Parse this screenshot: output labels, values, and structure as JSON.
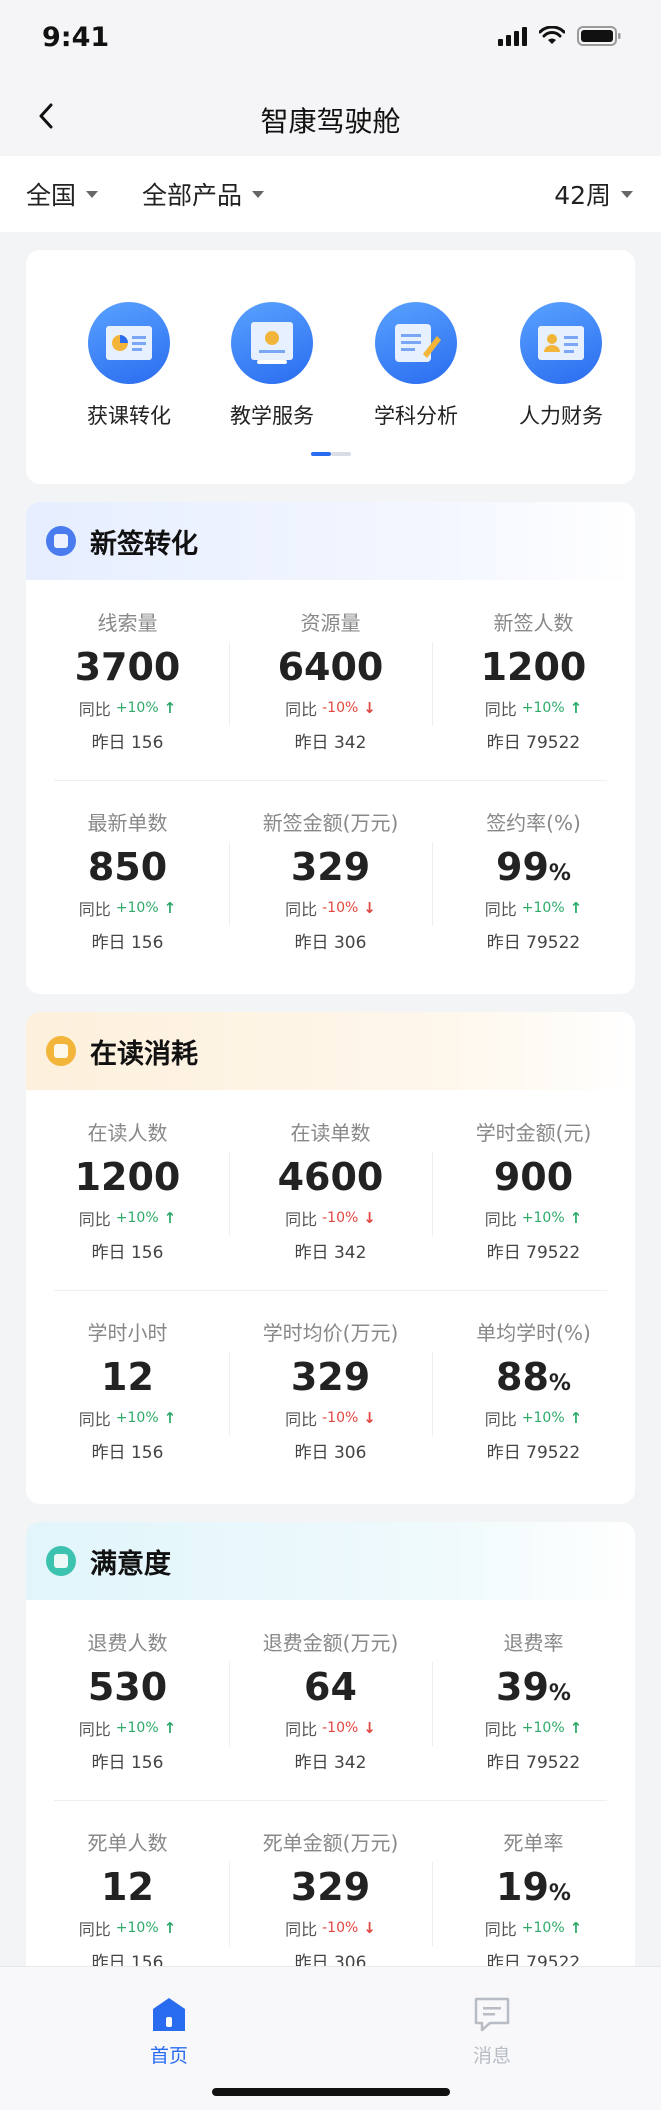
{
  "status_bar": {
    "time": "9:41"
  },
  "nav": {
    "title": "智康驾驶舱"
  },
  "filters": {
    "region": "全国",
    "product": "全部产品",
    "week": "42周"
  },
  "quick_menu": [
    {
      "label": "获课转化",
      "icon": "chart-screen-icon"
    },
    {
      "label": "教学服务",
      "icon": "certificate-icon"
    },
    {
      "label": "学科分析",
      "icon": "scroll-pen-icon"
    },
    {
      "label": "人力财务",
      "icon": "id-card-icon"
    }
  ],
  "sections": [
    {
      "title": "新签转化",
      "color": "#4a7cf0",
      "rows": [
        [
          {
            "label": "线索量",
            "value": "3700",
            "unit": "",
            "compare_label": "同比",
            "change": "+10%",
            "trend": "up",
            "yesterday": "昨日 156"
          },
          {
            "label": "资源量",
            "value": "6400",
            "unit": "",
            "compare_label": "同比",
            "change": "-10%",
            "trend": "down",
            "yesterday": "昨日 342"
          },
          {
            "label": "新签人数",
            "value": "1200",
            "unit": "",
            "compare_label": "同比",
            "change": "+10%",
            "trend": "up",
            "yesterday": "昨日 79522"
          }
        ],
        [
          {
            "label": "最新单数",
            "value": "850",
            "unit": "",
            "compare_label": "同比",
            "change": "+10%",
            "trend": "up",
            "yesterday": "昨日 156"
          },
          {
            "label": "新签金额(万元)",
            "value": "329",
            "unit": "",
            "compare_label": "同比",
            "change": "-10%",
            "trend": "down",
            "yesterday": "昨日 306"
          },
          {
            "label": "签约率(%)",
            "value": "99",
            "unit": "%",
            "compare_label": "同比",
            "change": "+10%",
            "trend": "up",
            "yesterday": "昨日 79522"
          }
        ]
      ]
    },
    {
      "title": "在读消耗",
      "color": "#f2b53a",
      "rows": [
        [
          {
            "label": "在读人数",
            "value": "1200",
            "unit": "",
            "compare_label": "同比",
            "change": "+10%",
            "trend": "up",
            "yesterday": "昨日 156"
          },
          {
            "label": "在读单数",
            "value": "4600",
            "unit": "",
            "compare_label": "同比",
            "change": "-10%",
            "trend": "down",
            "yesterday": "昨日 342"
          },
          {
            "label": "学时金额(元)",
            "value": "900",
            "unit": "",
            "compare_label": "同比",
            "change": "+10%",
            "trend": "up",
            "yesterday": "昨日 79522"
          }
        ],
        [
          {
            "label": "学时小时",
            "value": "12",
            "unit": "",
            "compare_label": "同比",
            "change": "+10%",
            "trend": "up",
            "yesterday": "昨日 156"
          },
          {
            "label": "学时均价(万元)",
            "value": "329",
            "unit": "",
            "compare_label": "同比",
            "change": "-10%",
            "trend": "down",
            "yesterday": "昨日 306"
          },
          {
            "label": "单均学时(%)",
            "value": "88",
            "unit": "%",
            "compare_label": "同比",
            "change": "+10%",
            "trend": "up",
            "yesterday": "昨日 79522"
          }
        ]
      ]
    },
    {
      "title": "满意度",
      "color": "#3cc3b0",
      "rows": [
        [
          {
            "label": "退费人数",
            "value": "530",
            "unit": "",
            "compare_label": "同比",
            "change": "+10%",
            "trend": "up",
            "yesterday": "昨日 156"
          },
          {
            "label": "退费金额(万元)",
            "value": "64",
            "unit": "",
            "compare_label": "同比",
            "change": "-10%",
            "trend": "down",
            "yesterday": "昨日 342"
          },
          {
            "label": "退费率",
            "value": "39",
            "unit": "%",
            "compare_label": "同比",
            "change": "+10%",
            "trend": "up",
            "yesterday": "昨日 79522"
          }
        ],
        [
          {
            "label": "死单人数",
            "value": "12",
            "unit": "",
            "compare_label": "同比",
            "change": "+10%",
            "trend": "up",
            "yesterday": "昨日 156"
          },
          {
            "label": "死单金额(万元)",
            "value": "329",
            "unit": "",
            "compare_label": "同比",
            "change": "-10%",
            "trend": "down",
            "yesterday": "昨日 306"
          },
          {
            "label": "死单率",
            "value": "19",
            "unit": "%",
            "compare_label": "同比",
            "change": "+10%",
            "trend": "up",
            "yesterday": "昨日 79522"
          }
        ]
      ]
    }
  ],
  "tab_bar": {
    "home": {
      "label": "首页",
      "color": "#2a6cf0"
    },
    "messages": {
      "label": "消息",
      "color": "#b8bcc4"
    }
  }
}
